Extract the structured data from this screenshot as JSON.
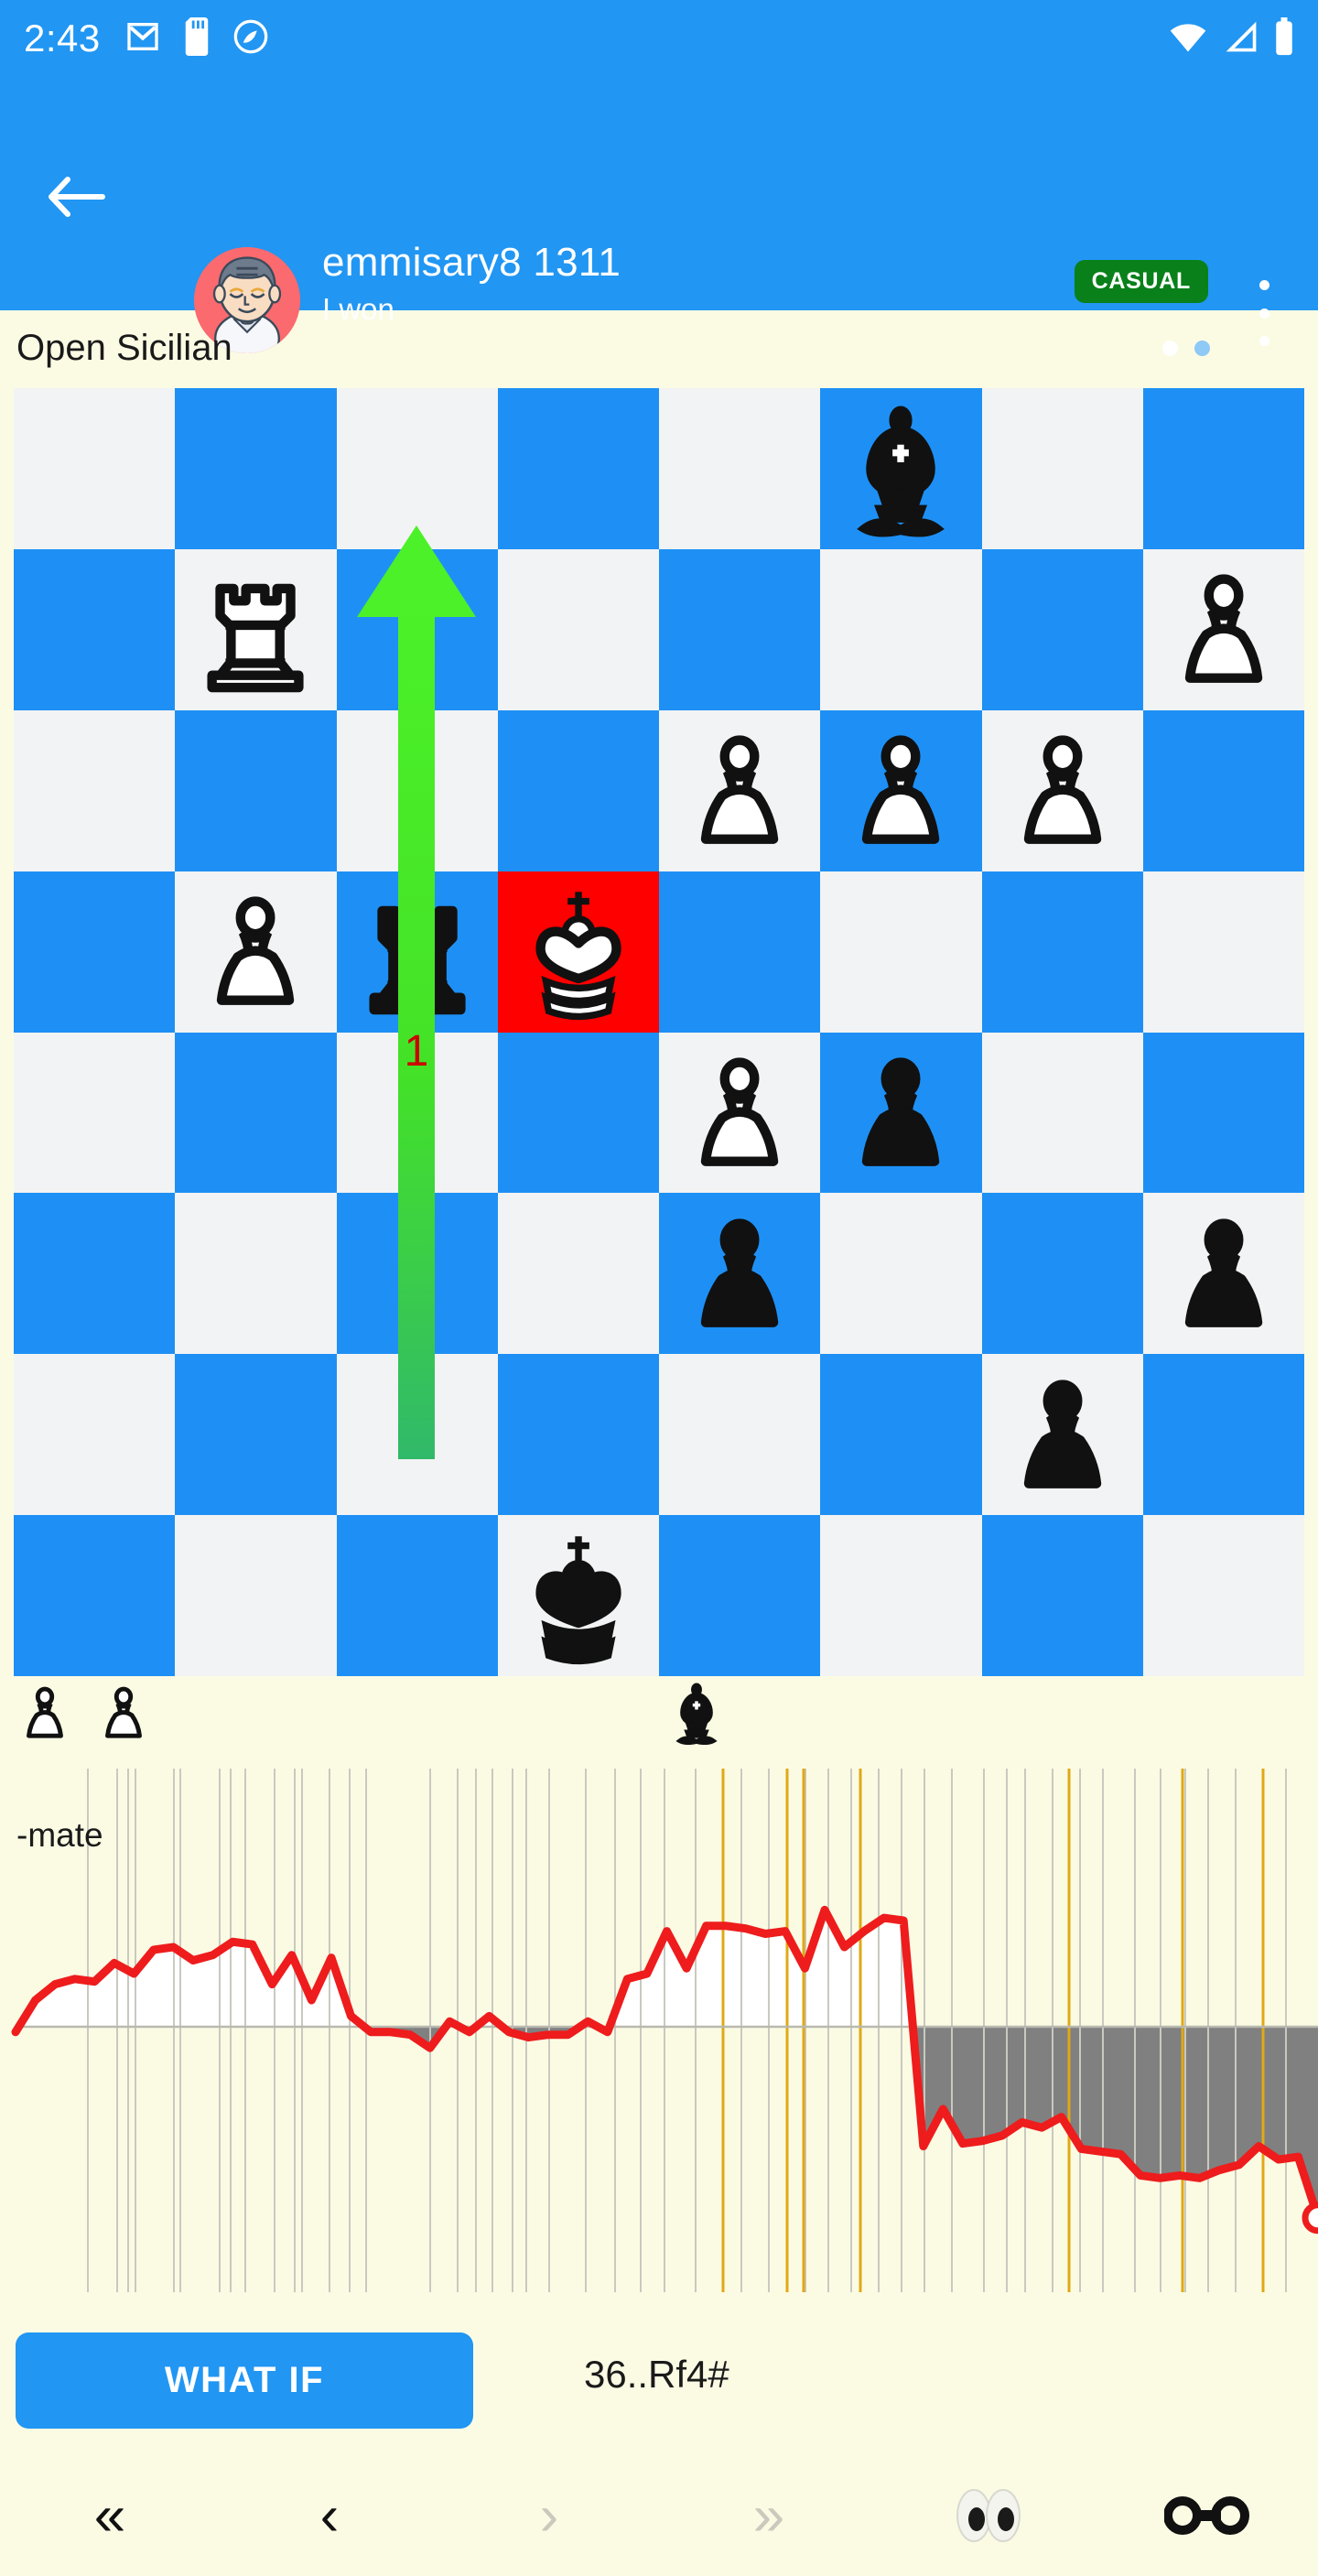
{
  "status_bar": {
    "time": "2:43",
    "left_icons": [
      "gmail-icon",
      "sd-card-icon",
      "circle-app-icon"
    ],
    "right_icons": [
      "wifi-icon",
      "cellular-signal-icon",
      "battery-icon"
    ]
  },
  "app_bar": {
    "back_icon": "back-arrow-icon",
    "avatar": "opponent-avatar",
    "opponent_name": "emmisary8 1311",
    "result_text": "I won",
    "badge_label": "CASUAL",
    "badge_color": "#09801a",
    "overflow_icon": "kebab-menu-icon",
    "page_dots": 2,
    "active_dot": 0,
    "background_color": "#2196f3"
  },
  "opening": {
    "label": "Open Sicilian"
  },
  "board": {
    "light_color": "#f2f3f4",
    "dark_color": "#1e90f5",
    "check_color": "#ff0000",
    "check_square": "d5",
    "orientation": "white-bottom-flipped",
    "squares": [
      {
        "sq": "a8",
        "shade": "light",
        "piece": null
      },
      {
        "sq": "b8",
        "shade": "dark",
        "piece": null
      },
      {
        "sq": "c8",
        "shade": "light",
        "piece": null
      },
      {
        "sq": "d8",
        "shade": "dark",
        "piece": null
      },
      {
        "sq": "e8",
        "shade": "light",
        "piece": null
      },
      {
        "sq": "f8",
        "shade": "dark",
        "piece": "black-bishop"
      },
      {
        "sq": "g8",
        "shade": "light",
        "piece": null
      },
      {
        "sq": "h8",
        "shade": "dark",
        "piece": null
      },
      {
        "sq": "a7",
        "shade": "dark",
        "piece": null
      },
      {
        "sq": "b7",
        "shade": "light",
        "piece": "white-rook"
      },
      {
        "sq": "c7",
        "shade": "dark",
        "piece": null
      },
      {
        "sq": "d7",
        "shade": "light",
        "piece": null
      },
      {
        "sq": "e7",
        "shade": "dark",
        "piece": null
      },
      {
        "sq": "f7",
        "shade": "light",
        "piece": null
      },
      {
        "sq": "g7",
        "shade": "dark",
        "piece": null
      },
      {
        "sq": "h7",
        "shade": "light",
        "piece": "white-pawn"
      },
      {
        "sq": "a6",
        "shade": "light",
        "piece": null
      },
      {
        "sq": "b6",
        "shade": "dark",
        "piece": null
      },
      {
        "sq": "c6",
        "shade": "light",
        "piece": null
      },
      {
        "sq": "d6",
        "shade": "dark",
        "piece": null
      },
      {
        "sq": "e6",
        "shade": "light",
        "piece": "white-pawn"
      },
      {
        "sq": "f6",
        "shade": "dark",
        "piece": "white-pawn"
      },
      {
        "sq": "g6",
        "shade": "light",
        "piece": "white-pawn"
      },
      {
        "sq": "h6",
        "shade": "dark",
        "piece": null
      },
      {
        "sq": "a5",
        "shade": "dark",
        "piece": null
      },
      {
        "sq": "b5",
        "shade": "light",
        "piece": "white-pawn"
      },
      {
        "sq": "c5",
        "shade": "dark",
        "piece": "black-rook"
      },
      {
        "sq": "d5",
        "shade": "check",
        "piece": "white-king"
      },
      {
        "sq": "e5",
        "shade": "dark",
        "piece": null
      },
      {
        "sq": "f5",
        "shade": "light",
        "piece": null
      },
      {
        "sq": "g5",
        "shade": "dark",
        "piece": null
      },
      {
        "sq": "h5",
        "shade": "light",
        "piece": null
      },
      {
        "sq": "a4",
        "shade": "light",
        "piece": null
      },
      {
        "sq": "b4",
        "shade": "dark",
        "piece": null
      },
      {
        "sq": "c4",
        "shade": "light",
        "piece": null
      },
      {
        "sq": "d4",
        "shade": "dark",
        "piece": null
      },
      {
        "sq": "e4",
        "shade": "light",
        "piece": "white-pawn"
      },
      {
        "sq": "f4",
        "shade": "dark",
        "piece": "black-pawn"
      },
      {
        "sq": "g4",
        "shade": "light",
        "piece": null
      },
      {
        "sq": "h4",
        "shade": "dark",
        "piece": null
      },
      {
        "sq": "a3",
        "shade": "dark",
        "piece": null
      },
      {
        "sq": "b3",
        "shade": "light",
        "piece": null
      },
      {
        "sq": "c3",
        "shade": "dark",
        "piece": null
      },
      {
        "sq": "d3",
        "shade": "light",
        "piece": null
      },
      {
        "sq": "e3",
        "shade": "dark",
        "piece": "black-pawn"
      },
      {
        "sq": "f3",
        "shade": "light",
        "piece": null
      },
      {
        "sq": "g3",
        "shade": "dark",
        "piece": null
      },
      {
        "sq": "h3",
        "shade": "light",
        "piece": "black-pawn"
      },
      {
        "sq": "a2",
        "shade": "light",
        "piece": null
      },
      {
        "sq": "b2",
        "shade": "dark",
        "piece": null
      },
      {
        "sq": "c2",
        "shade": "light",
        "piece": null
      },
      {
        "sq": "d2",
        "shade": "dark",
        "piece": null
      },
      {
        "sq": "e2",
        "shade": "light",
        "piece": null
      },
      {
        "sq": "f2",
        "shade": "dark",
        "piece": null
      },
      {
        "sq": "g2",
        "shade": "light",
        "piece": "black-pawn"
      },
      {
        "sq": "h2",
        "shade": "dark",
        "piece": null
      },
      {
        "sq": "a1",
        "shade": "dark",
        "piece": null
      },
      {
        "sq": "b1",
        "shade": "light",
        "piece": null
      },
      {
        "sq": "c1",
        "shade": "dark",
        "piece": null
      },
      {
        "sq": "d1",
        "shade": "light",
        "piece": "black-king"
      },
      {
        "sq": "e1",
        "shade": "dark",
        "piece": null
      },
      {
        "sq": "f1",
        "shade": "light",
        "piece": null
      },
      {
        "sq": "g1",
        "shade": "dark",
        "piece": null
      },
      {
        "sq": "h1",
        "shade": "light",
        "piece": null
      }
    ],
    "arrow": {
      "from": "c1",
      "to": "c5",
      "color": "#46e321",
      "label": "1",
      "label_color": "#cc0000"
    }
  },
  "captured": {
    "white_pieces": [
      "white-pawn",
      "white-pawn"
    ],
    "black_pieces": [
      "black-bishop"
    ]
  },
  "chart_data": {
    "type": "area",
    "title": "",
    "xlabel": "",
    "ylabel": "",
    "ylim": [
      -1,
      1
    ],
    "grid": true,
    "annotations": [
      {
        "text": "-mate",
        "position": "top-left"
      }
    ],
    "line_color": "#ee1c1c",
    "positive_fill": "#ffffff",
    "negative_fill": "#808080",
    "background": "#fbfbe4",
    "zero_line": 0,
    "series": [
      {
        "name": "evaluation",
        "values": [
          -0.02,
          0.1,
          0.16,
          0.18,
          0.17,
          0.24,
          0.2,
          0.29,
          0.3,
          0.25,
          0.27,
          0.32,
          0.31,
          0.16,
          0.27,
          0.1,
          0.26,
          0.04,
          -0.02,
          -0.02,
          -0.03,
          -0.08,
          0.02,
          -0.02,
          0.04,
          -0.02,
          -0.04,
          -0.03,
          -0.03,
          0.02,
          -0.02,
          0.18,
          0.2,
          0.36,
          0.22,
          0.38,
          0.38,
          0.37,
          0.35,
          0.36,
          0.22,
          0.44,
          0.3,
          0.36,
          0.41,
          0.4,
          -0.45,
          -0.31,
          -0.44,
          -0.43,
          -0.41,
          -0.36,
          -0.38,
          -0.34,
          -0.46,
          -0.47,
          -0.48,
          -0.56,
          -0.57,
          -0.56,
          -0.57,
          -0.54,
          -0.52,
          -0.45,
          -0.5,
          -0.49,
          -0.72
        ]
      }
    ]
  },
  "actions": {
    "what_if_label": "WHAT IF",
    "move_text": "36..Rf4#"
  },
  "bottom_nav": [
    {
      "name": "first-move-button",
      "glyph": "«",
      "enabled": true
    },
    {
      "name": "previous-move-button",
      "glyph": "‹",
      "enabled": true
    },
    {
      "name": "next-move-button",
      "glyph": "›",
      "enabled": false
    },
    {
      "name": "last-move-button",
      "glyph": "»",
      "enabled": false
    },
    {
      "name": "analysis-eyes-button",
      "glyph": "eyes-icon",
      "enabled": true
    },
    {
      "name": "share-link-button",
      "glyph": "link-icon",
      "enabled": true
    }
  ]
}
